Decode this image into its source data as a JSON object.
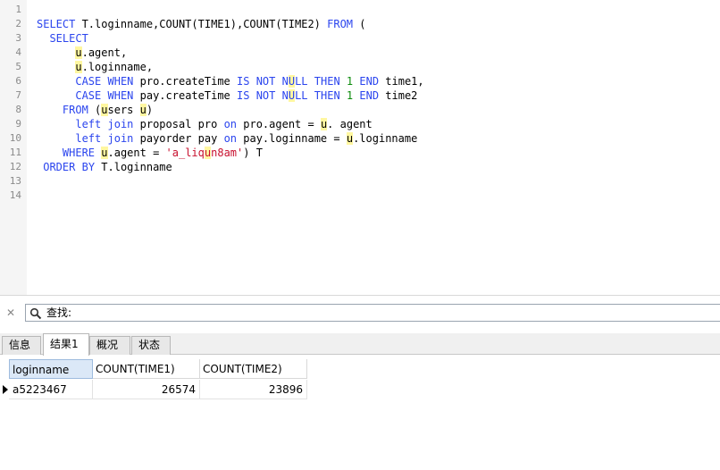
{
  "editor": {
    "line_numbers": [
      "1",
      "2",
      "3",
      "4",
      "5",
      "6",
      "7",
      "8",
      "9",
      "10",
      "11",
      "12",
      "13",
      "14"
    ],
    "lines": [
      [],
      [
        {
          "t": "SELECT",
          "c": "kw"
        },
        {
          "t": " T.loginname,COUNT(TIME1),COUNT(TIME2) "
        },
        {
          "t": "FROM",
          "c": "kw"
        },
        {
          "t": " ("
        }
      ],
      [
        {
          "t": "  "
        },
        {
          "t": "SELECT",
          "c": "kw"
        }
      ],
      [
        {
          "t": "      "
        },
        {
          "t": "u",
          "c": "hl"
        },
        {
          "t": ".agent,"
        }
      ],
      [
        {
          "t": "      "
        },
        {
          "t": "u",
          "c": "hl"
        },
        {
          "t": ".loginname,"
        }
      ],
      [
        {
          "t": "      "
        },
        {
          "t": "CASE",
          "c": "kw"
        },
        {
          "t": " "
        },
        {
          "t": "WHEN",
          "c": "kw"
        },
        {
          "t": " pro.createTime "
        },
        {
          "t": "IS",
          "c": "kw"
        },
        {
          "t": " "
        },
        {
          "t": "NOT",
          "c": "kw"
        },
        {
          "t": " "
        },
        {
          "t": "N",
          "c": "kw"
        },
        {
          "t": "U",
          "c": "kw hl"
        },
        {
          "t": "LL",
          "c": "kw"
        },
        {
          "t": " "
        },
        {
          "t": "THEN",
          "c": "kw"
        },
        {
          "t": " "
        },
        {
          "t": "1",
          "c": "num"
        },
        {
          "t": " "
        },
        {
          "t": "END",
          "c": "kw"
        },
        {
          "t": " time1,"
        }
      ],
      [
        {
          "t": "      "
        },
        {
          "t": "CASE",
          "c": "kw"
        },
        {
          "t": " "
        },
        {
          "t": "WHEN",
          "c": "kw"
        },
        {
          "t": " pay.createTime "
        },
        {
          "t": "IS",
          "c": "kw"
        },
        {
          "t": " "
        },
        {
          "t": "NOT",
          "c": "kw"
        },
        {
          "t": " "
        },
        {
          "t": "N",
          "c": "kw"
        },
        {
          "t": "U",
          "c": "kw hl"
        },
        {
          "t": "LL",
          "c": "kw"
        },
        {
          "t": " "
        },
        {
          "t": "THEN",
          "c": "kw"
        },
        {
          "t": " "
        },
        {
          "t": "1",
          "c": "num"
        },
        {
          "t": " "
        },
        {
          "t": "END",
          "c": "kw"
        },
        {
          "t": " time2"
        }
      ],
      [
        {
          "t": "    "
        },
        {
          "t": "FROM",
          "c": "kw"
        },
        {
          "t": " ("
        },
        {
          "t": "u",
          "c": "hl"
        },
        {
          "t": "sers "
        },
        {
          "t": "u",
          "c": "hl"
        },
        {
          "t": ")"
        }
      ],
      [
        {
          "t": "      "
        },
        {
          "t": "left",
          "c": "kw"
        },
        {
          "t": " "
        },
        {
          "t": "join",
          "c": "kw"
        },
        {
          "t": " proposal pro "
        },
        {
          "t": "on",
          "c": "kw"
        },
        {
          "t": " pro.agent = "
        },
        {
          "t": "u",
          "c": "hl"
        },
        {
          "t": ". agent"
        }
      ],
      [
        {
          "t": "      "
        },
        {
          "t": "left",
          "c": "kw"
        },
        {
          "t": " "
        },
        {
          "t": "join",
          "c": "kw"
        },
        {
          "t": " payorder pay "
        },
        {
          "t": "on",
          "c": "kw"
        },
        {
          "t": " pay.loginname = "
        },
        {
          "t": "u",
          "c": "hl"
        },
        {
          "t": ".loginname"
        }
      ],
      [
        {
          "t": "    "
        },
        {
          "t": "WHERE",
          "c": "kw"
        },
        {
          "t": " "
        },
        {
          "t": "u",
          "c": "hl"
        },
        {
          "t": ".agent = "
        },
        {
          "t": "'a_liq",
          "c": "str"
        },
        {
          "t": "u",
          "c": "str hl"
        },
        {
          "t": "n8am'",
          "c": "str"
        },
        {
          "t": ") T"
        }
      ],
      [
        {
          "t": " "
        },
        {
          "t": "ORDER",
          "c": "kw"
        },
        {
          "t": " "
        },
        {
          "t": "BY",
          "c": "kw"
        },
        {
          "t": " T.loginname"
        }
      ],
      [],
      []
    ],
    "colors": {
      "keyword": "#2b45ee",
      "number": "#0a8a0a",
      "string": "#c8102e",
      "highlight": "#fff7a0"
    }
  },
  "findbar": {
    "close_icon": "close-icon",
    "search_icon": "search-icon",
    "label": "查找:"
  },
  "tabs": [
    {
      "label": "信息",
      "active": false
    },
    {
      "label": "结果1",
      "active": true
    },
    {
      "label": "概况",
      "active": false
    },
    {
      "label": "状态",
      "active": false
    }
  ],
  "results": {
    "columns": [
      "loginname",
      "COUNT(TIME1)",
      "COUNT(TIME2)"
    ],
    "rows": [
      [
        "a5223467",
        "26574",
        "23896"
      ]
    ],
    "row_indicator_icon": "current-row-arrow-icon"
  }
}
